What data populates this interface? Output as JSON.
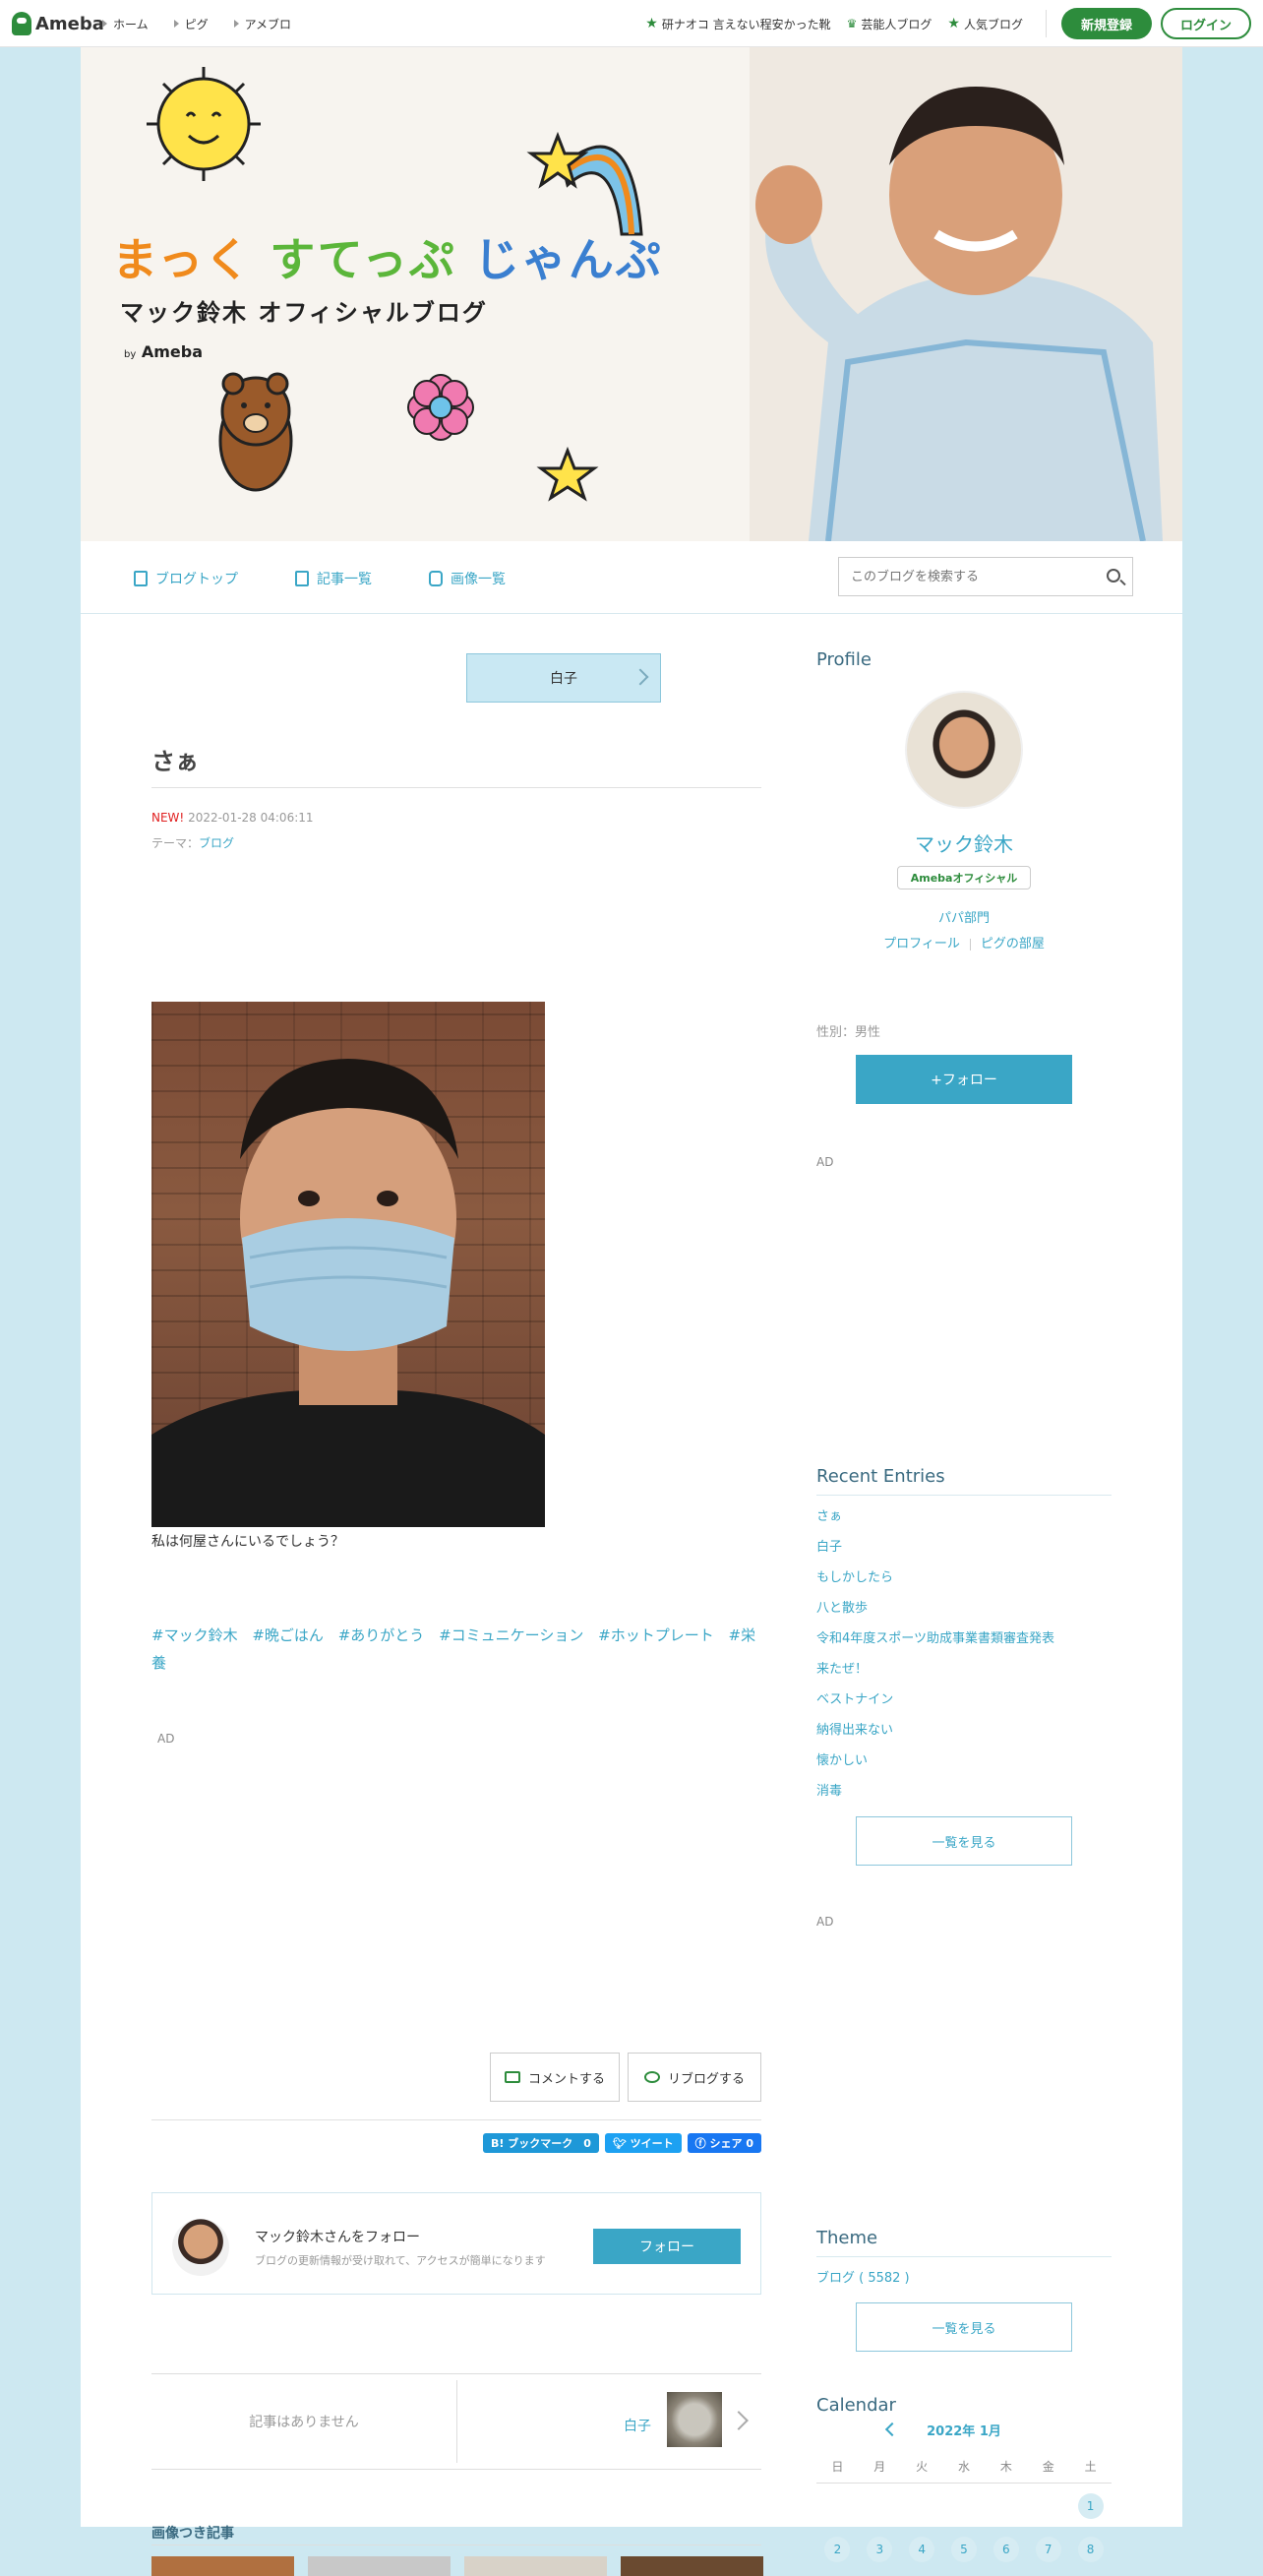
{
  "global_header": {
    "logo_text": "Ameba",
    "nav": [
      "ホーム",
      "ピグ",
      "アメブロ"
    ],
    "right_links": [
      {
        "icon": "star-icon",
        "label": "研ナオコ 言えない程安かった靴"
      },
      {
        "icon": "crown-icon",
        "label": "芸能人ブログ"
      },
      {
        "icon": "star-icon",
        "label": "人気ブログ"
      }
    ],
    "register_label": "新規登録",
    "login_label": "ログイン"
  },
  "banner": {
    "title_parts": [
      "まっく",
      "すてっぷ",
      "じゃんぷ"
    ],
    "subtitle": "マック鈴木 オフィシャルブログ",
    "by_prefix": "by",
    "by_brand": "Ameba"
  },
  "blog_nav": {
    "items": [
      "ブログトップ",
      "記事一覧",
      "画像一覧"
    ],
    "search_placeholder": "このブログを検索する"
  },
  "entry": {
    "next_entry_label": "白子",
    "title": "さぁ",
    "new_label": "NEW!",
    "datetime": "2022-01-28 04:06:11",
    "theme_prefix": "テーマ：",
    "theme": "ブログ",
    "body_text": "私は何屋さんにいるでしょう？",
    "hashtags": [
      "#マック鈴木",
      "#晩ごはん",
      "#ありがとう",
      "#コミュニケーション",
      "#ホットプレート",
      "#栄養"
    ],
    "ad_label": "AD",
    "comment_label": "コメントする",
    "reblog_label": "リブログする",
    "share": {
      "hatena": "B! ブックマーク　0",
      "tweet": "ツイート",
      "facebook": "シェア 0"
    }
  },
  "follow_box": {
    "title": "マック鈴木さんをフォロー",
    "subtitle": "ブログの更新情報が受け取れて、アクセスが簡単になります",
    "button": "フォロー"
  },
  "pager": {
    "prev_label": "記事はありません",
    "next_label": "白子"
  },
  "image_articles": {
    "title": "画像つき記事"
  },
  "sidebar": {
    "profile_heading": "Profile",
    "name": "マック鈴木",
    "official_badge": "Amebaオフィシャル",
    "category": "パパ部門",
    "links": [
      "プロフィール",
      "ピグの部屋"
    ],
    "gender": "性別：男性",
    "follow_button": "+フォロー",
    "ad_label": "AD",
    "recent_heading": "Recent Entries",
    "recent_entries": [
      "さぁ",
      "白子",
      "もしかしたら",
      "八と散歩",
      "令和4年度スポーツ助成事業書類審査発表",
      "来たぜ！",
      "ベストナイン",
      "納得出来ない",
      "懐かしい",
      "消毒"
    ],
    "see_all": "一覧を見る",
    "theme_heading": "Theme",
    "theme_item": "ブログ ( 5582 )",
    "calendar_heading": "Calendar",
    "calendar_month": "2022年 1月",
    "weekdays": [
      "日",
      "月",
      "火",
      "水",
      "木",
      "金",
      "土"
    ],
    "calendar_row1": [
      "",
      "",
      "",
      "",
      "",
      "",
      "1"
    ],
    "calendar_row2": [
      "2",
      "3",
      "4",
      "5",
      "6",
      "7",
      "8"
    ]
  }
}
